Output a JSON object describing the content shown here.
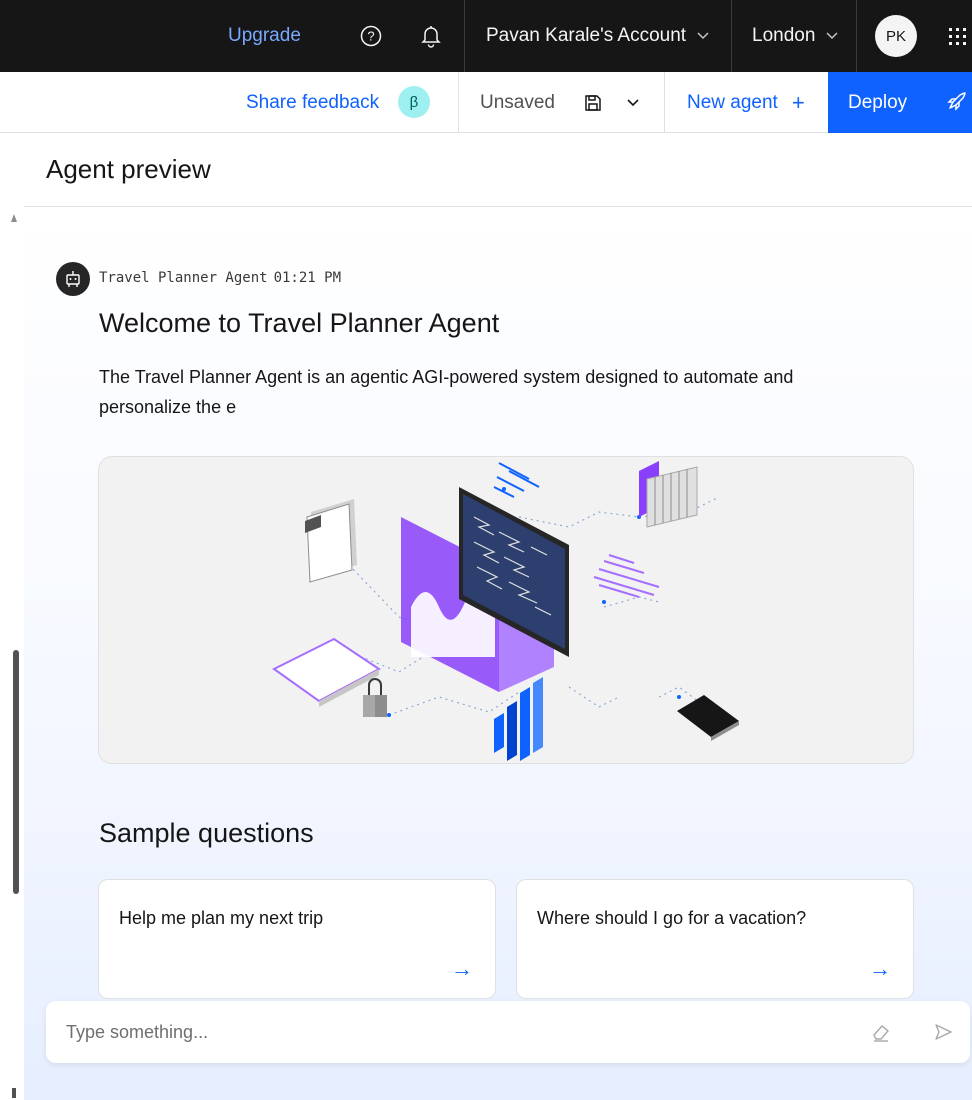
{
  "topbar": {
    "upgrade_label": "Upgrade",
    "help_icon": "help-circle-icon",
    "notification_icon": "bell-icon",
    "account_label": "Pavan Karale's Account",
    "region_label": "London",
    "avatar_initials": "PK",
    "apps_icon": "app-switcher-icon"
  },
  "toolbar": {
    "share_feedback_label": "Share feedback",
    "beta_badge": "β",
    "save_status": "Unsaved",
    "save_icon": "save-icon",
    "new_agent_label": "New agent",
    "new_agent_icon": "+",
    "deploy_label": "Deploy",
    "deploy_icon": "rocket-icon"
  },
  "panel": {
    "title": "Agent preview"
  },
  "message": {
    "sender": "Travel Planner Agent",
    "time": "01:21 PM",
    "heading": "Welcome to Travel Planner Agent",
    "body": "The Travel Planner Agent is an agentic AGI-powered system designed to automate and personalize the e"
  },
  "sample_questions": {
    "title": "Sample questions",
    "items": [
      {
        "text": "Help me plan my next trip",
        "arrow": "→"
      },
      {
        "text": "Where should I go for a vacation?",
        "arrow": "→"
      }
    ]
  },
  "composer": {
    "placeholder": "Type something...",
    "clear_icon": "eraser-icon",
    "send_icon": "send-icon"
  },
  "colors": {
    "topbar_bg": "#161616",
    "accent": "#0f62fe",
    "upgrade_link": "#78a9ff",
    "beta_bg": "#9ef0f0"
  }
}
